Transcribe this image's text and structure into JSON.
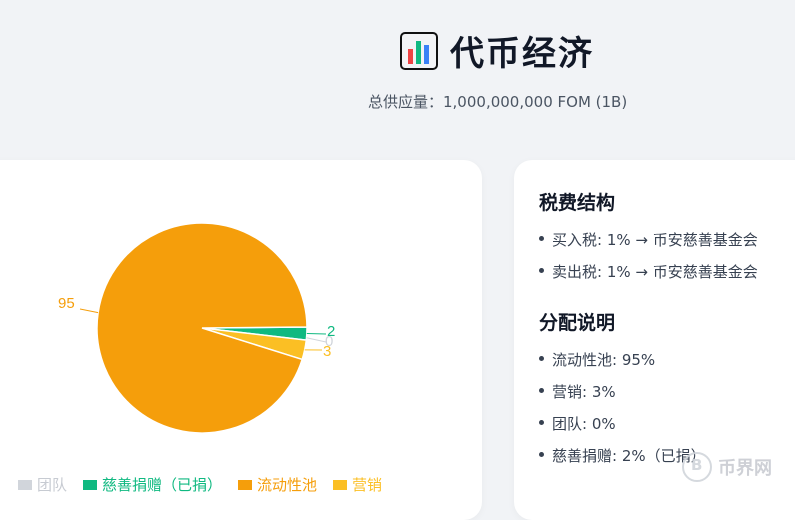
{
  "header": {
    "title": "代币经济",
    "subtitle": "总供应量：1,000,000,000 FOM (1B)"
  },
  "chart_data": {
    "type": "pie",
    "categories": [
      "团队",
      "慈善捐赠（已捐）",
      "流动性池",
      "营销"
    ],
    "values": [
      0,
      2,
      95,
      3
    ],
    "colors": [
      "#d1d5db",
      "#10b981",
      "#f59e0b",
      "#fbbf24"
    ],
    "data_labels": [
      "0",
      "2",
      "95",
      "3"
    ],
    "legend_placement": "bottom",
    "legend_hidden": [
      "团队"
    ]
  },
  "info": {
    "tax_heading": "税费结构",
    "tax_items": [
      "买入税: 1% → 币安慈善基金会",
      "卖出税: 1% → 币安慈善基金会"
    ],
    "dist_heading": "分配说明",
    "dist_items": [
      "流动性池: 95%",
      "营销: 3%",
      "团队: 0%",
      "慈善捐赠: 2%（已捐）"
    ]
  },
  "watermark": {
    "text": "币界网"
  }
}
